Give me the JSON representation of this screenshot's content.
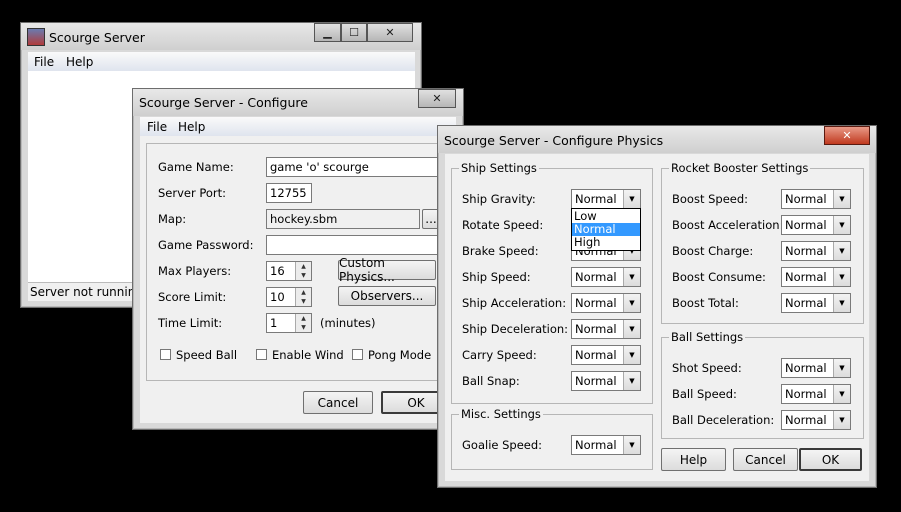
{
  "main_window": {
    "title": "Scourge Server",
    "menu": [
      "File",
      "Help"
    ],
    "status": "Server not running."
  },
  "configure": {
    "title": "Scourge Server - Configure",
    "menu": [
      "File",
      "Help"
    ],
    "game_name_label": "Game Name:",
    "game_name_value": "game 'o' scourge",
    "server_port_label": "Server Port:",
    "server_port_value": "12755",
    "map_label": "Map:",
    "map_value": "hockey.sbm",
    "map_browse": "...",
    "password_label": "Game Password:",
    "password_value": "",
    "max_players_label": "Max Players:",
    "max_players_value": "16",
    "score_limit_label": "Score Limit:",
    "score_limit_value": "10",
    "time_limit_label": "Time Limit:",
    "time_limit_value": "1",
    "time_unit": "(minutes)",
    "custom_physics": "Custom Physics...",
    "observers": "Observers...",
    "speed_ball": "Speed Ball",
    "enable_wind": "Enable Wind",
    "pong_mode": "Pong Mode",
    "cancel": "Cancel",
    "ok": "OK"
  },
  "physics": {
    "title": "Scourge Server - Configure Physics",
    "ship_group": "Ship Settings",
    "ship_gravity": "Ship Gravity:",
    "rotate_speed": "Rotate Speed:",
    "brake_speed": "Brake Speed:",
    "ship_speed": "Ship Speed:",
    "ship_accel": "Ship Acceleration:",
    "ship_decel": "Ship Deceleration:",
    "carry_speed": "Carry Speed:",
    "ball_snap": "Ball Snap:",
    "misc_group": "Misc. Settings",
    "goalie_speed": "Goalie Speed:",
    "rocket_group": "Rocket Booster Settings",
    "boost_speed": "Boost Speed:",
    "boost_accel": "Boost Acceleration:",
    "boost_charge": "Boost Charge:",
    "boost_consume": "Boost Consume:",
    "boost_total": "Boost Total:",
    "ball_group": "Ball Settings",
    "shot_speed": "Shot Speed:",
    "ball_speed": "Ball Speed:",
    "ball_decel": "Ball Deceleration:",
    "value": "Normal",
    "options": [
      "Low",
      "Normal",
      "High"
    ],
    "help": "Help",
    "cancel": "Cancel",
    "ok": "OK"
  }
}
